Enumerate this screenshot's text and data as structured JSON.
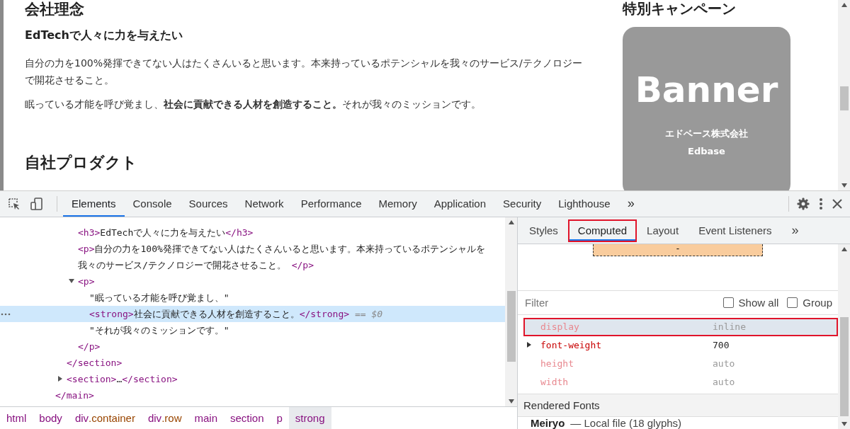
{
  "page": {
    "heading": "会社理念",
    "subheading": "EdTechで人々に力を与えたい",
    "paragraphs": [
      "自分の力を100%発揮できてない人はたくさんいると思います。本来持っているポテンシャルを我々のサービス/テクノロジーで開花させること。",
      "眠っている才能を呼び覚まし、**社会に貢献できる人材を創造すること。**それが我々のミッションです。"
    ],
    "next_heading": "自社プロダクト",
    "aside": {
      "heading": "特別キャンペーン",
      "banner": {
        "title": "Banner",
        "company": "エドベース株式会社",
        "brand": "Edbase"
      }
    }
  },
  "devtools": {
    "tabs": [
      {
        "label": "Elements",
        "selected": true
      },
      {
        "label": "Console",
        "selected": false
      },
      {
        "label": "Sources",
        "selected": false
      },
      {
        "label": "Network",
        "selected": false
      },
      {
        "label": "Performance",
        "selected": false
      },
      {
        "label": "Memory",
        "selected": false
      },
      {
        "label": "Application",
        "selected": false
      },
      {
        "label": "Security",
        "selected": false
      },
      {
        "label": "Lighthouse",
        "selected": false
      }
    ],
    "overflow": "»",
    "dom_tree": [
      {
        "close": [
          {
            "kind": "tag",
            "text": "</main>"
          }
        ],
        "children": [
          {
            "close": [
              {
                "kind": "tag",
                "text": "</section>"
              }
            ],
            "children": [
              {
                "selected": false,
                "segments": [
                  {
                    "kind": "tag",
                    "text": "<h3>"
                  },
                  {
                    "kind": "text",
                    "text": "EdTechで人々に力を与えたい"
                  },
                  {
                    "kind": "tag",
                    "text": "</h3>"
                  }
                ]
              },
              {
                "selected": false,
                "segments": [
                  {
                    "kind": "tag",
                    "text": "<p>"
                  },
                  {
                    "kind": "text",
                    "text": "自分の力を100%発揮できてない人はたくさんいると思います。本来持っているポテンシャルを我々のサービス/テクノロジーで開花させること。 "
                  },
                  {
                    "kind": "tag",
                    "text": "</p>"
                  }
                ]
              },
              {
                "selected": false,
                "expanded": true,
                "segments": [
                  {
                    "kind": "tag",
                    "text": "<p>"
                  }
                ],
                "close": [
                  {
                    "kind": "tag",
                    "text": "</p>"
                  }
                ],
                "children": [
                  {
                    "selected": false,
                    "segments": [
                      {
                        "kind": "text",
                        "text": "\"眠っている才能を呼び覚まし、\""
                      }
                    ]
                  },
                  {
                    "selected": true,
                    "segments": [
                      {
                        "kind": "tag",
                        "text": "<strong>"
                      },
                      {
                        "kind": "text",
                        "text": "社会に貢献できる人材を創造すること。"
                      },
                      {
                        "kind": "tag",
                        "text": "</strong>"
                      },
                      {
                        "kind": "hint",
                        "text": " == $0"
                      }
                    ]
                  },
                  {
                    "selected": false,
                    "segments": [
                      {
                        "kind": "text",
                        "text": "\"それが我々のミッションです。\""
                      }
                    ]
                  }
                ]
              }
            ]
          },
          {
            "selected": false,
            "expanded": false,
            "segments": [
              {
                "kind": "tag",
                "text": "<section>"
              },
              {
                "kind": "text",
                "text": "…"
              },
              {
                "kind": "tag",
                "text": "</section>"
              }
            ]
          }
        ]
      }
    ],
    "breadcrumbs": [
      {
        "tag": "html",
        "selected": false
      },
      {
        "tag": "body",
        "selected": false
      },
      {
        "tag": "div",
        "cls": ".container",
        "selected": false
      },
      {
        "tag": "div",
        "cls": ".row",
        "selected": false
      },
      {
        "tag": "main",
        "selected": false
      },
      {
        "tag": "section",
        "selected": false
      },
      {
        "tag": "p",
        "selected": false
      },
      {
        "tag": "strong",
        "selected": true
      }
    ],
    "sidebar_tabs": [
      {
        "label": "Styles",
        "selected": false
      },
      {
        "label": "Computed",
        "selected": true
      },
      {
        "label": "Layout",
        "selected": false
      },
      {
        "label": "Event Listeners",
        "selected": false
      }
    ],
    "sidebar_overflow": "»",
    "box_model": {
      "value": "-"
    },
    "filter": {
      "placeholder": "Filter"
    },
    "options": [
      {
        "label": "Show all",
        "checked": false
      },
      {
        "label": "Group",
        "checked": false
      }
    ],
    "properties": [
      {
        "name": "display",
        "value": "inline",
        "dimmed": true,
        "selected": true
      },
      {
        "name": "font-weight",
        "value": "700",
        "dimmed": false,
        "selected": false,
        "expanded": false
      },
      {
        "name": "height",
        "value": "auto",
        "dimmed": true,
        "selected": false
      },
      {
        "name": "width",
        "value": "auto",
        "dimmed": true,
        "selected": false
      }
    ],
    "rendered_fonts": {
      "heading": "Rendered Fonts",
      "font": "Meiryo",
      "detail": "— Local file (18 glyphs)"
    }
  }
}
